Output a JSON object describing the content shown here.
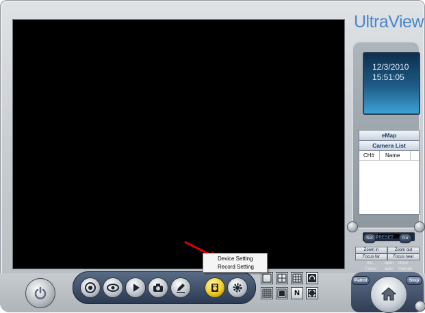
{
  "app": {
    "logo": "UltraView",
    "colors": {
      "brand": "#4b86c9",
      "video_bg": "#000000",
      "accent_yellow": "#f0cc1f"
    }
  },
  "clock": {
    "date": "12/3/2010",
    "time": "15:51:05"
  },
  "panel": {
    "emap_tab": "eMap",
    "camera_list_tab": "Camera List",
    "camera_list": {
      "columns": [
        "CH#",
        "Name"
      ],
      "rows": []
    }
  },
  "ptz": {
    "set_label": "Set",
    "preset_label": "PRESET",
    "go_label": "Go",
    "zoom_in": "Zoom in",
    "zoom_out": "Zoom out",
    "focus_far": "Focus far",
    "focus_near": "Focus near",
    "iris_label": "Iris",
    "focus_label": "Focus",
    "open_label": "open",
    "close_label": "close",
    "auto_label": "auto",
    "manual_label": "manual",
    "patrol_label": "Patrol",
    "stop_label": "Stop"
  },
  "toolbar": {
    "icons": [
      "power-icon",
      "record-icon",
      "view-icon",
      "play-icon",
      "snapshot-icon",
      "edit-icon",
      "setting-folder-icon",
      "gear-icon"
    ],
    "active": "setting-folder-icon"
  },
  "layout_buttons": {
    "row1": [
      "single-view-icon",
      "quad-view-icon",
      "nine-view-icon",
      "rotate-view-icon"
    ],
    "row2": [
      "sixteen-view-icon",
      "pip-view-icon",
      "n-view-icon",
      "fullscreen-icon"
    ],
    "n_label": "N"
  },
  "context_menu": {
    "items": [
      "Device Setting",
      "Record Setting"
    ]
  }
}
